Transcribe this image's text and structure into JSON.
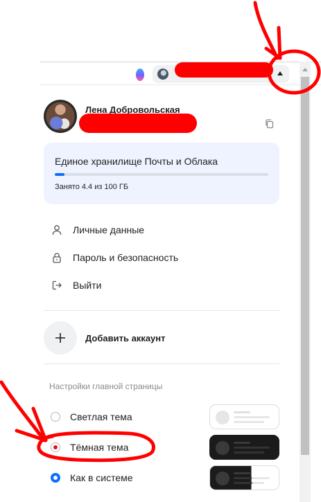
{
  "header": {
    "assistant_icon": "assistant-orb-icon",
    "account_caret_icon": "caret-up-icon"
  },
  "profile": {
    "name": "Лена Добровольская",
    "copy_icon": "copy-icon"
  },
  "storage": {
    "title": "Единое хранилище Почты и Облака",
    "used_text": "Занято 4.4 из 100 ГБ",
    "used_fraction": 0.044,
    "fill_color": "#0d6efd"
  },
  "menu": {
    "items": [
      {
        "label": "Личные данные",
        "icon": "person-icon"
      },
      {
        "label": "Пароль и безопасность",
        "icon": "lock-icon"
      },
      {
        "label": "Выйти",
        "icon": "logout-icon"
      }
    ]
  },
  "add_account": {
    "label": "Добавить аккаунт",
    "icon": "plus-icon"
  },
  "settings": {
    "section_title": "Настройки главной страницы",
    "themes": [
      {
        "label": "Светлая тема",
        "selected": false
      },
      {
        "label": "Тёмная тема",
        "selected": false
      },
      {
        "label": "Как в системе",
        "selected": true
      }
    ]
  },
  "annotation": {
    "color": "#ff0000"
  }
}
